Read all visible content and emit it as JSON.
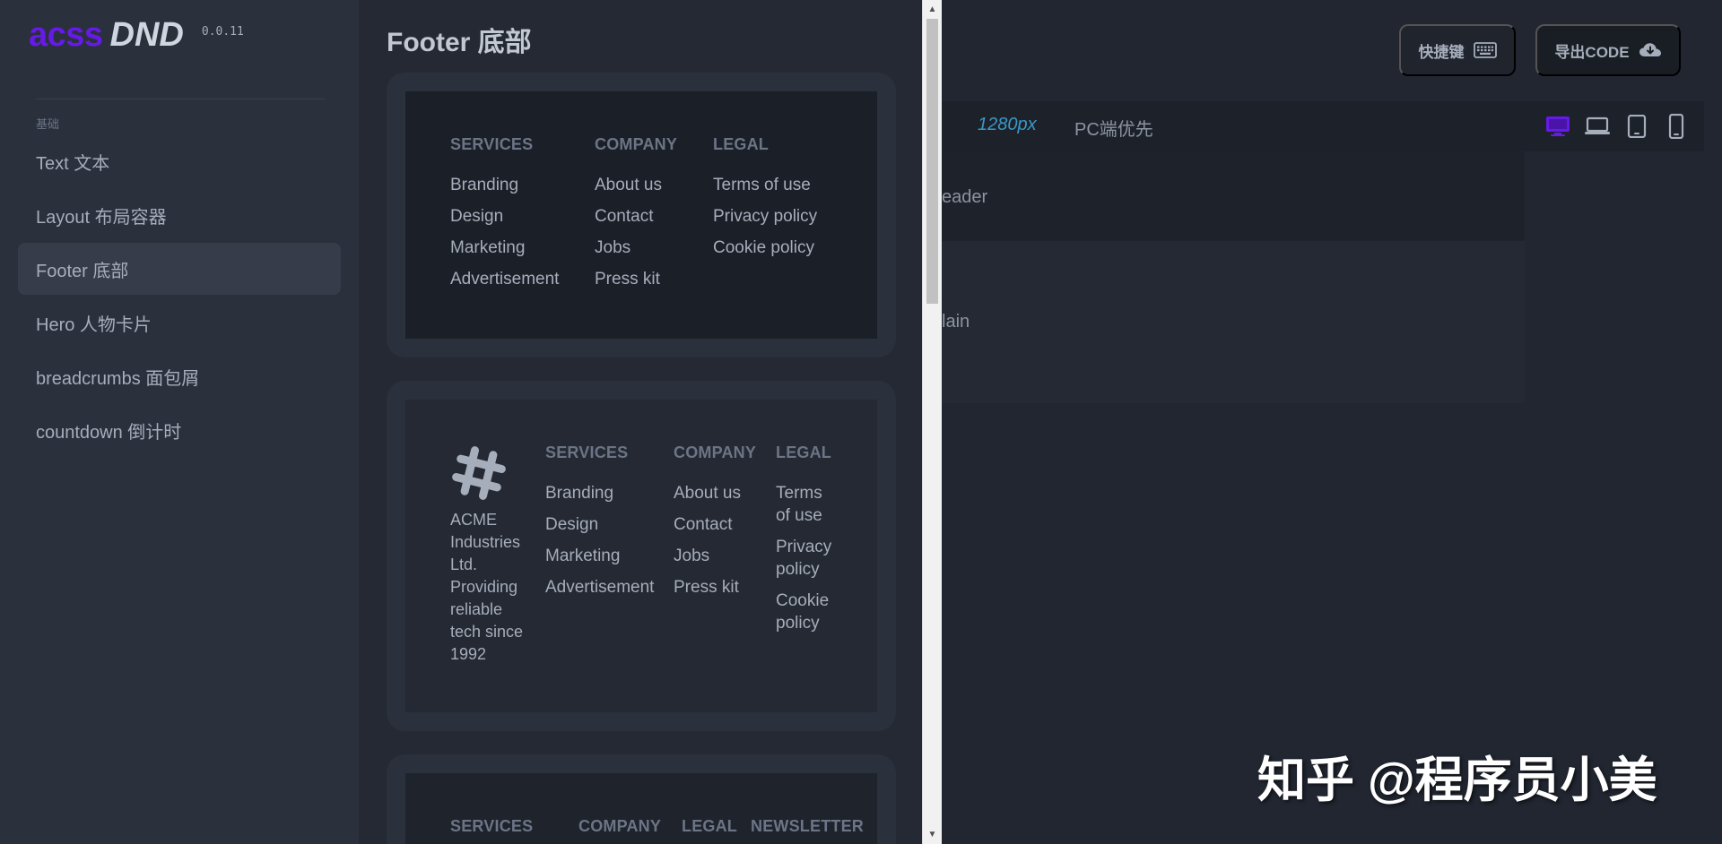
{
  "brand": {
    "name_part1": "acss",
    "name_part2": "DND",
    "version": "0.0.11"
  },
  "sidebar": {
    "section_title": "基础",
    "items": [
      {
        "label": "Text 文本",
        "active": false
      },
      {
        "label": "Layout 布局容器",
        "active": false
      },
      {
        "label": "Footer 底部",
        "active": true
      },
      {
        "label": "Hero 人物卡片",
        "active": false
      },
      {
        "label": "breadcrumbs 面包屑",
        "active": false
      },
      {
        "label": "countdown 倒计时",
        "active": false
      }
    ]
  },
  "panel": {
    "title": "Footer 底部",
    "footer1": {
      "columns": [
        {
          "title": "SERVICES",
          "links": [
            "Branding",
            "Design",
            "Marketing",
            "Advertisement"
          ]
        },
        {
          "title": "COMPANY",
          "links": [
            "About us",
            "Contact",
            "Jobs",
            "Press kit"
          ]
        },
        {
          "title": "LEGAL",
          "links": [
            "Terms of use",
            "Privacy policy",
            "Cookie policy"
          ]
        }
      ]
    },
    "footer2": {
      "company_text": "ACME Industries Ltd. Providing reliable tech since 1992",
      "columns": [
        {
          "title": "SERVICES",
          "links": [
            "Branding",
            "Design",
            "Marketing",
            "Advertisement"
          ]
        },
        {
          "title": "COMPANY",
          "links": [
            "About us",
            "Contact",
            "Jobs",
            "Press kit"
          ]
        },
        {
          "title": "LEGAL",
          "links": [
            "Terms of use",
            "Privacy policy",
            "Cookie policy"
          ]
        }
      ]
    },
    "footer3": {
      "columns": [
        {
          "title": "SERVICES"
        },
        {
          "title": "COMPANY"
        },
        {
          "title": "LEGAL"
        },
        {
          "title": "NEWSLETTER"
        }
      ]
    }
  },
  "main": {
    "shortcut_button": "快捷键",
    "export_button": "导出CODE",
    "width_label": "1280px",
    "mode_label": "PC端优先",
    "canvas_header_label": "eader",
    "canvas_main_label": "lain",
    "watermark": "知乎 @程序员小美"
  },
  "colors": {
    "brand_accent": "#661ae6",
    "active_device": "#661ae6",
    "width_label": "#3a97c7",
    "sidebar_bg": "#2a303c",
    "panel_bg": "#242933"
  }
}
